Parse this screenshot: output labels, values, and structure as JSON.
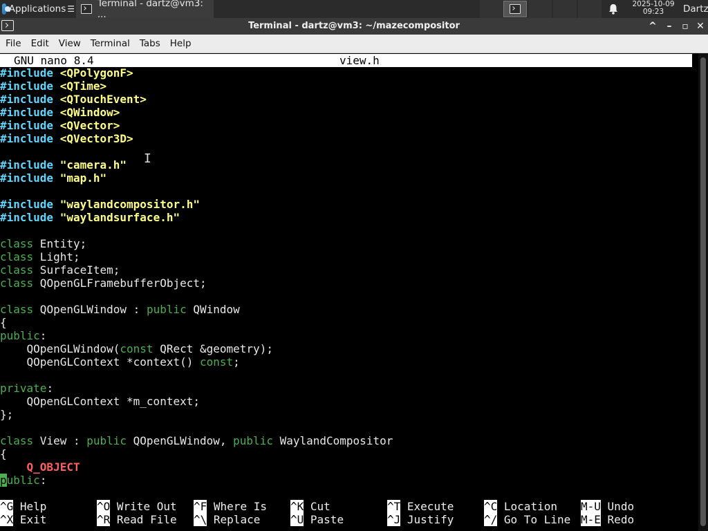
{
  "panel": {
    "apps_label": "Applications",
    "apps_menu_mark": "☰",
    "task_label": "Terminal - dartz@vm3: ...",
    "date": "2025-10-09",
    "time": "09:23",
    "user": "Dartz"
  },
  "window": {
    "title": "Terminal - dartz@vm3: ~/mazecompositor",
    "btn_up": "^",
    "btn_min": "–",
    "btn_max": "▫",
    "btn_close": "✕"
  },
  "menu": [
    "File",
    "Edit",
    "View",
    "Terminal",
    "Tabs",
    "Help"
  ],
  "nano": {
    "version": "GNU nano 8.4",
    "filename": "view.h"
  },
  "code": {
    "l1_kw": "#include",
    "l1_val": "<QPolygonF>",
    "l2_kw": "#include",
    "l2_val": "<QTime>",
    "l3_kw": "#include",
    "l3_val": "<QTouchEvent>",
    "l4_kw": "#include",
    "l4_val": "<QWindow>",
    "l5_kw": "#include",
    "l5_val": "<QVector>",
    "l6_kw": "#include",
    "l6_val": "<QVector3D>",
    "l8_kw": "#include",
    "l8_val": "\"camera.h\"",
    "l9_kw": "#include",
    "l9_val": "\"map.h\"",
    "l11_kw": "#include",
    "l11_val": "\"waylandcompositor.h\"",
    "l12_kw": "#include",
    "l12_val": "\"waylandsurface.h\"",
    "l14_kw": "class",
    "l14_rest": " Entity;",
    "l15_kw": "class",
    "l15_rest": " Light;",
    "l16_kw": "class",
    "l16_rest": " SurfaceItem;",
    "l17_kw": "class",
    "l17_rest": " QOpenGLFramebufferObject;",
    "l19_kw": "class",
    "l19_a": " QOpenGLWindow : ",
    "l19_kw2": "public",
    "l19_b": " QWindow",
    "l20": "{",
    "l21_kw": "public",
    "l21_rest": ":",
    "l22_a": "    QOpenGLWindow(",
    "l22_kw": "const",
    "l22_b": " QRect &geometry);",
    "l23_a": "    QOpenGLContext *context() ",
    "l23_kw": "const",
    "l23_b": ";",
    "l25_kw": "private",
    "l25_rest": ":",
    "l26": "    QOpenGLContext *m_context;",
    "l27": "};",
    "l29_kw": "class",
    "l29_a": " View : ",
    "l29_kw2": "public",
    "l29_b": " QOpenGLWindow, ",
    "l29_kw3": "public",
    "l29_c": " WaylandCompositor",
    "l30": "{",
    "l31_indent": "    ",
    "l31_mac": "Q_OBJECT",
    "l32_cur": "p",
    "l32_kw": "ublic",
    "l32_rest": ":"
  },
  "shortcuts": [
    {
      "key": "^G",
      "label": "Help"
    },
    {
      "key": "^O",
      "label": "Write Out"
    },
    {
      "key": "^F",
      "label": "Where Is"
    },
    {
      "key": "^K",
      "label": "Cut"
    },
    {
      "key": "^T",
      "label": "Execute"
    },
    {
      "key": "^C",
      "label": "Location"
    },
    {
      "key": "M-U",
      "label": "Undo"
    },
    {
      "key": "^X",
      "label": "Exit"
    },
    {
      "key": "^R",
      "label": "Read File"
    },
    {
      "key": "^\\",
      "label": "Replace"
    },
    {
      "key": "^U",
      "label": "Paste"
    },
    {
      "key": "^J",
      "label": "Justify"
    },
    {
      "key": "^/",
      "label": "Go To Line"
    },
    {
      "key": "M-E",
      "label": "Redo"
    }
  ],
  "colors": {
    "include": "#5fd7ff",
    "string": "#ffff87",
    "keyword": "#4caf50",
    "macro": "#ff5f5f"
  }
}
